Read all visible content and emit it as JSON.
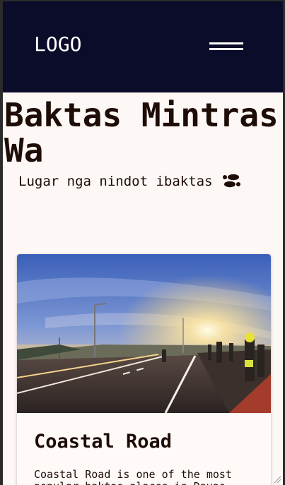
{
  "navbar": {
    "logo": "LOGO",
    "menu_icon": "hamburger-menu-icon"
  },
  "hero": {
    "title": "Baktas Mintras Wa",
    "tagline": "Lugar nga nindot ibaktas",
    "tagline_icon": "footprints-icon"
  },
  "cards": [
    {
      "image": "coastal-road-sunrise-photo",
      "title": "Coastal Road",
      "body": "Coastal Road is one of the most popular baktas places in Davao"
    }
  ],
  "colors": {
    "navbar_bg": "#0b0b2a",
    "page_bg": "#fdf8f6",
    "text": "#1e0c06"
  }
}
